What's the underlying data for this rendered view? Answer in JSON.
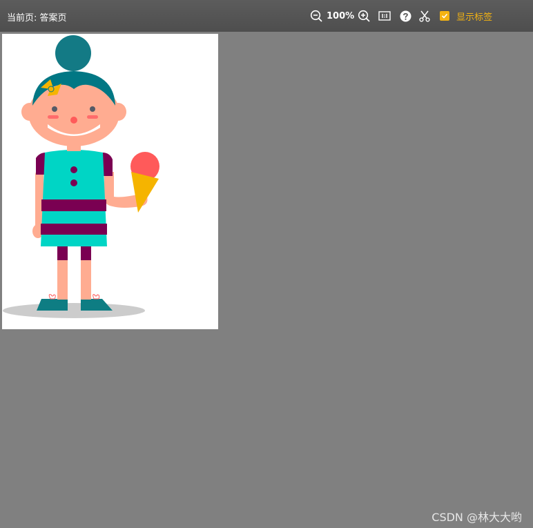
{
  "header": {
    "page_label": "当前页: 答案页"
  },
  "toolbar": {
    "zoom_out_icon": "zoom-out-icon",
    "zoom_level": "100%",
    "zoom_in_icon": "zoom-in-icon",
    "fit_icon": "actual-size-icon",
    "help_icon": "help-icon",
    "cut_icon": "scissors-icon",
    "show_labels_label": "显示标签",
    "show_labels_checked": true,
    "accent_color": "#f4b312"
  },
  "canvas": {
    "illustration": "girl-with-ice-cream",
    "background": "#ffffff"
  },
  "watermark": {
    "text": "CSDN @林大大哟"
  }
}
